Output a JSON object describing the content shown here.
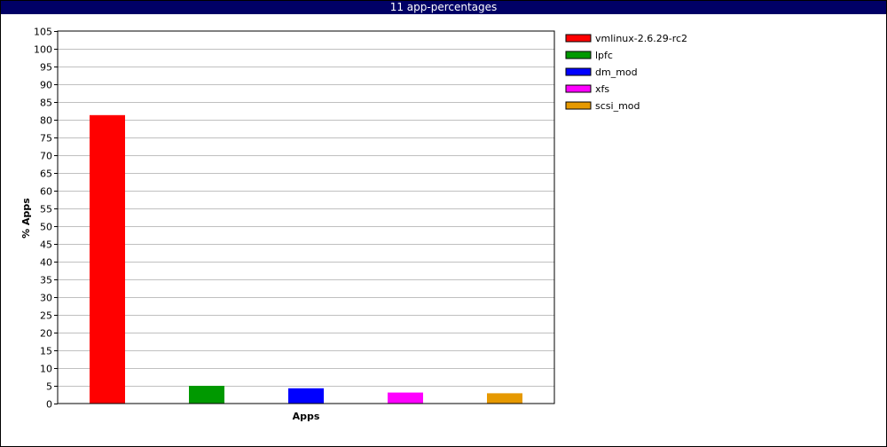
{
  "window": {
    "title": "11 app-percentages"
  },
  "chart_data": {
    "type": "bar",
    "title": "11 app-percentages",
    "xlabel": "Apps",
    "ylabel": "% Apps",
    "ylim": [
      0,
      105
    ],
    "ytick_step": 5,
    "grid": true,
    "legend_position": "right",
    "categories": [
      "vmlinux-2.6.29-rc2",
      "lpfc",
      "dm_mod",
      "xfs",
      "scsi_mod"
    ],
    "values": [
      81.3,
      5.0,
      4.3,
      3.1,
      2.9
    ],
    "colors": [
      "#ff0000",
      "#009900",
      "#0000ff",
      "#ff00ff",
      "#e69900"
    ]
  }
}
